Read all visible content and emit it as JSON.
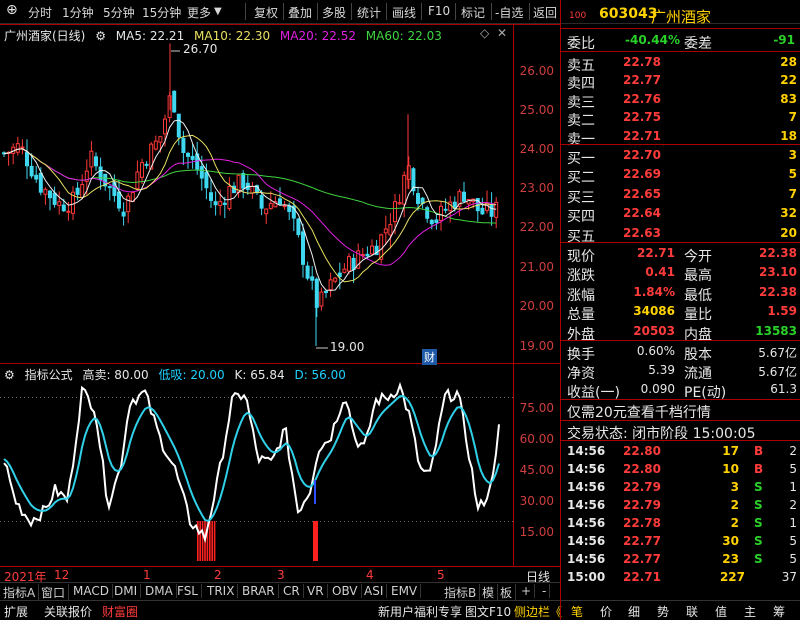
{
  "toolbar": {
    "left_items": [
      "分时",
      "1分钟",
      "5分钟",
      "15分钟",
      "更多"
    ],
    "right_items": [
      "复权",
      "叠加",
      "多股",
      "统计",
      "画线",
      "F10",
      "标记",
      "-自选",
      "返回"
    ]
  },
  "stock": {
    "code": "603043",
    "name": "广州酒家",
    "prefix": "100"
  },
  "main_chart": {
    "title": "广州酒家(日线)",
    "ma5": "MA5: 22.21",
    "ma10": "MA10: 22.30",
    "ma20": "MA20: 22.52",
    "ma60": "MA60: 22.03",
    "high_mark": "26.70",
    "low_mark": "19.00",
    "cai_marker": "财",
    "y_ticks": [
      "26.00",
      "25.00",
      "24.00",
      "23.00",
      "22.00",
      "21.00",
      "20.00",
      "19.00"
    ]
  },
  "indicator": {
    "title": "指标公式",
    "high_label": "高卖: 80.00",
    "low_label": "低吸: 20.00",
    "k_label": "K: 65.84",
    "d_label": "D: 56.00",
    "y_ticks": [
      "75.00",
      "60.00",
      "45.00",
      "30.00",
      "15.00"
    ]
  },
  "x_axis": {
    "labels": [
      "2021年",
      "12",
      "1",
      "2",
      "3",
      "4",
      "5"
    ],
    "period": "日线"
  },
  "indicator_tabs": [
    "指标A",
    "窗口",
    "MACD",
    "DMI",
    "DMA",
    "FSL",
    "TRIX",
    "BRAR",
    "CR",
    "VR",
    "OBV",
    "ASI",
    "EMV",
    "指标B",
    "模",
    "板",
    "+",
    "-"
  ],
  "bottom_bar": {
    "left": [
      "扩展",
      "关联报价",
      "财富圈"
    ],
    "mid": [
      "新用户福利专享",
      "图文F10",
      "侧边栏《"
    ],
    "right": [
      "笔",
      "价",
      "细",
      "势",
      "联",
      "值",
      "主",
      "筹"
    ]
  },
  "quote": {
    "weibi_label": "委比",
    "weibi": "-40.44%",
    "weicha_label": "委差",
    "weicha": "-91",
    "asks": [
      {
        "label": "卖五",
        "price": "22.78",
        "vol": "28"
      },
      {
        "label": "卖四",
        "price": "22.77",
        "vol": "22"
      },
      {
        "label": "卖三",
        "price": "22.76",
        "vol": "83"
      },
      {
        "label": "卖二",
        "price": "22.75",
        "vol": "7"
      },
      {
        "label": "卖一",
        "price": "22.71",
        "vol": "18"
      }
    ],
    "bids": [
      {
        "label": "买一",
        "price": "22.70",
        "vol": "3"
      },
      {
        "label": "买二",
        "price": "22.69",
        "vol": "5"
      },
      {
        "label": "买三",
        "price": "22.65",
        "vol": "7"
      },
      {
        "label": "买四",
        "price": "22.64",
        "vol": "32"
      },
      {
        "label": "买五",
        "price": "22.63",
        "vol": "20"
      }
    ],
    "stats": [
      {
        "l1": "现价",
        "v1": "22.71",
        "l2": "今开",
        "v2": "22.38"
      },
      {
        "l1": "涨跌",
        "v1": "0.41",
        "l2": "最高",
        "v2": "23.10"
      },
      {
        "l1": "涨幅",
        "v1": "1.84%",
        "l2": "最低",
        "v2": "22.38"
      },
      {
        "l1": "总量",
        "v1": "34086",
        "l2": "量比",
        "v2": "1.59"
      },
      {
        "l1": "外盘",
        "v1": "20503",
        "l2": "内盘",
        "v2": "13583"
      }
    ],
    "stats2": [
      {
        "l1": "换手",
        "v1": "0.60%",
        "l2": "股本",
        "v2": "5.67亿"
      },
      {
        "l1": "净资",
        "v1": "5.39",
        "l2": "流通",
        "v2": "5.67亿"
      },
      {
        "l1": "收益(一)",
        "v1": "0.090",
        "l2": "PE(动)",
        "v2": "61.3"
      }
    ],
    "promo": "仅需20元查看千档行情",
    "trade_status": "交易状态: 闭市阶段 15:00:05",
    "ticks": [
      {
        "time": "14:56",
        "price": "22.80",
        "vol": "17",
        "bs": "B",
        "n": "2"
      },
      {
        "time": "14:56",
        "price": "22.80",
        "vol": "10",
        "bs": "B",
        "n": "5"
      },
      {
        "time": "14:56",
        "price": "22.79",
        "vol": "3",
        "bs": "S",
        "n": "1"
      },
      {
        "time": "14:56",
        "price": "22.79",
        "vol": "2",
        "bs": "S",
        "n": "2"
      },
      {
        "time": "14:56",
        "price": "22.78",
        "vol": "2",
        "bs": "S",
        "n": "1"
      },
      {
        "time": "14:56",
        "price": "22.77",
        "vol": "30",
        "bs": "S",
        "n": "5"
      },
      {
        "time": "14:56",
        "price": "22.77",
        "vol": "23",
        "bs": "S",
        "n": "5"
      },
      {
        "time": "15:00",
        "price": "22.71",
        "vol": "227",
        "bs": "",
        "n": "37"
      }
    ]
  }
}
